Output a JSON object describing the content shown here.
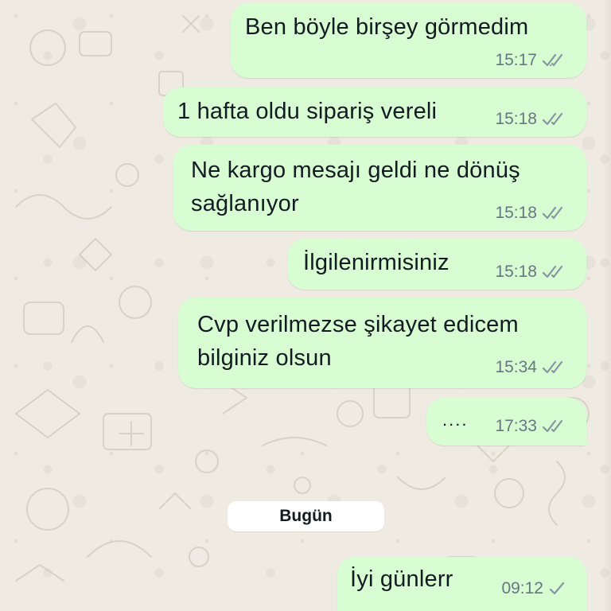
{
  "messages": [
    {
      "text": "Ben böyle birşey görmedim",
      "time": "15:17",
      "status": "read"
    },
    {
      "text": "1 hafta oldu sipariş vereli",
      "time": "15:18",
      "status": "read"
    },
    {
      "text_line1": "Ne kargo mesajı geldi ne dönüş",
      "text_line2": "sağlanıyor",
      "time": "15:18",
      "status": "read"
    },
    {
      "text": "İlgilenirmisiniz",
      "time": "15:18",
      "status": "read"
    },
    {
      "text_line1": "Cvp verilmezse şikayet edicem",
      "text_line2": "bilginiz olsun",
      "time": "15:34",
      "status": "read"
    },
    {
      "text": "....",
      "time": "17:33",
      "status": "read"
    },
    {
      "text": "İyi günlerr",
      "time": "09:12",
      "status": "sent"
    }
  ],
  "date_divider": "Bugün",
  "colors": {
    "bubble_outgoing": "#d9fdd3",
    "background": "#efeae2",
    "meta_text": "#667781",
    "tick": "#8696a0"
  },
  "icons": {
    "read_status": "double-check-icon",
    "sent_status": "single-check-icon"
  }
}
